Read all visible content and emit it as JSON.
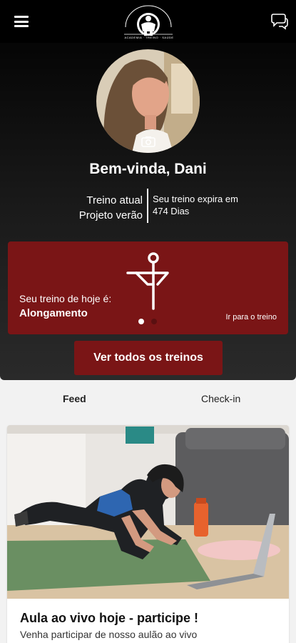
{
  "header": {
    "logo_text": "BODYBUILDING AND FITNESS",
    "logo_subtext": "ACADEMIA · TREINO · SAÚDE",
    "menu_icon": "hamburger-menu-icon",
    "chat_icon": "chat-bubbles-icon"
  },
  "profile": {
    "greeting": "Bem-vinda, Dani",
    "current_label": "Treino atual",
    "current_plan": "Projeto verão",
    "expiry_label": "Seu treino expira em",
    "expiry_value": "474 Dias",
    "camera_icon": "camera-icon"
  },
  "today": {
    "label": "Seu treino de hoje é:",
    "workout": "Alongamento",
    "go_link": "Ir para o treino",
    "icon": "stretching-figure-icon",
    "slides_total": 2,
    "slide_active": 1
  },
  "actions": {
    "all_workouts": "Ver todos os treinos"
  },
  "tabs": {
    "feed": "Feed",
    "checkin": "Check-in"
  },
  "feed": {
    "title": "Aula ao vivo hoje - participe !",
    "description": "Venha participar de nosso aulão ao vivo"
  },
  "colors": {
    "accent": "#7a1516",
    "header_bg": "#000000",
    "page_bg": "#f2f2f2"
  }
}
